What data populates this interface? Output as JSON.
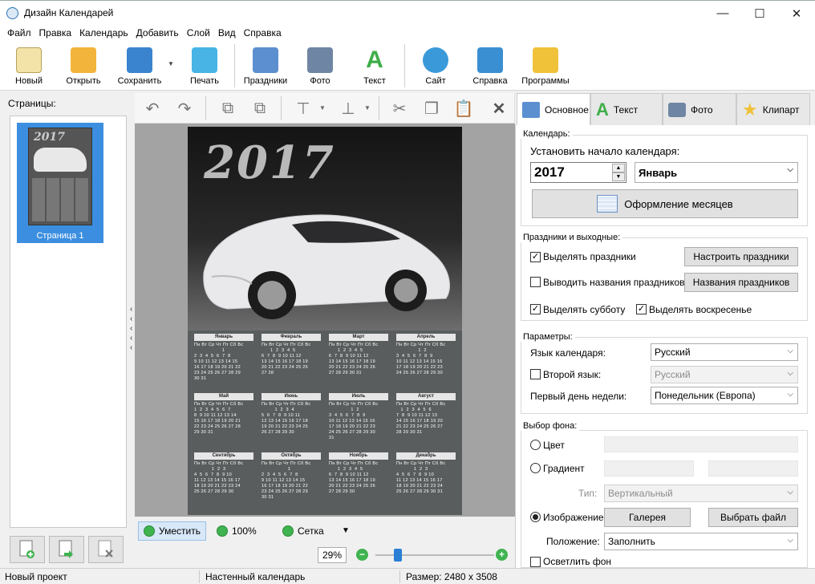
{
  "window": {
    "title": "Дизайн Календарей",
    "minimize": "—",
    "maximize": "☐",
    "close": "✕"
  },
  "menu": [
    "Файл",
    "Правка",
    "Календарь",
    "Добавить",
    "Слой",
    "Вид",
    "Справка"
  ],
  "toolbar": [
    {
      "label": "Новый",
      "icon": "new-document-icon",
      "color": "#f4e3a8"
    },
    {
      "label": "Открыть",
      "icon": "folder-icon",
      "color": "#f3b43b"
    },
    {
      "label": "Сохранить",
      "icon": "floppy-disk-icon",
      "color": "#3a83cf"
    },
    {
      "label": "Печать",
      "icon": "printer-icon",
      "color": "#47b4e5"
    },
    {
      "label": "Праздники",
      "icon": "calendar-icon",
      "color": "#5b8fcf"
    },
    {
      "label": "Фото",
      "icon": "camera-icon",
      "color": "#6e86a3"
    },
    {
      "label": "Текст",
      "icon": "text-a-icon",
      "color": "#3fae49"
    },
    {
      "label": "Сайт",
      "icon": "globe-icon",
      "color": "#3a9ad9"
    },
    {
      "label": "Справка",
      "icon": "help-book-icon",
      "color": "#3a8fd2"
    },
    {
      "label": "Программы",
      "icon": "box-icon",
      "color": "#f0c23a"
    }
  ],
  "pages": {
    "label": "Страницы:",
    "items": [
      {
        "label": "Страница 1",
        "year": "2017"
      }
    ]
  },
  "poster": {
    "year": "2017"
  },
  "months": [
    {
      "name": "Январь",
      "rows": [
        "Пн Вт Ср Чт Пт Сб Вс",
        "                   1",
        "2  3  4  5  6  7  8",
        "9 10 11 12 13 14 15",
        "16 17 18 19 20 21 22",
        "23 24 25 26 27 28 29",
        "30 31"
      ]
    },
    {
      "name": "Февраль",
      "rows": [
        "Пн Вт Ср Чт Пт Сб Вс",
        "      1  2  3  4  5",
        "6  7  8  9 10 11 12",
        "13 14 15 16 17 18 19",
        "20 21 22 23 24 25 26",
        "27 28"
      ]
    },
    {
      "name": "Март",
      "rows": [
        "Пн Вт Ср Чт Пт Сб Вс",
        "      1  2  3  4  5",
        "6  7  8  9 10 11 12",
        "13 14 15 16 17 18 19",
        "20 21 22 23 24 25 26",
        "27 28 29 30 31"
      ]
    },
    {
      "name": "Апрель",
      "rows": [
        "Пн Вт Ср Чт Пт Сб Вс",
        "               1  2",
        "3  4  5  6  7  8  9",
        "10 11 12 13 14 15 16",
        "17 18 19 20 21 22 23",
        "24 25 26 27 28 29 30"
      ]
    },
    {
      "name": "Май",
      "rows": [
        "Пн Вт Ср Чт Пт Сб Вс",
        "1  2  3  4  5  6  7",
        "8  9 10 11 12 13 14",
        "15 16 17 18 19 20 21",
        "22 23 24 25 26 27 28",
        "29 30 31"
      ]
    },
    {
      "name": "Июнь",
      "rows": [
        "Пн Вт Ср Чт Пт Сб Вс",
        "         1  2  3  4",
        "5  6  7  8  9 10 11",
        "12 13 14 15 16 17 18",
        "19 20 21 22 23 24 25",
        "26 27 28 29 30"
      ]
    },
    {
      "name": "Июль",
      "rows": [
        "Пн Вт Ср Чт Пт Сб Вс",
        "               1  2",
        "3  4  5  6  7  8  9",
        "10 11 12 13 14 15 16",
        "17 18 19 20 21 22 23",
        "24 25 26 27 28 29 30",
        "31"
      ]
    },
    {
      "name": "Август",
      "rows": [
        "Пн Вт Ср Чт Пт Сб Вс",
        "   1  2  3  4  5  6",
        "7  8  9 10 11 12 13",
        "14 15 16 17 18 19 20",
        "21 22 23 24 25 26 27",
        "28 29 30 31"
      ]
    },
    {
      "name": "Сентябрь",
      "rows": [
        "Пн Вт Ср Чт Пт Сб Вс",
        "            1  2  3",
        "4  5  6  7  8  9 10",
        "11 12 13 14 15 16 17",
        "18 19 20 21 22 23 24",
        "25 26 27 28 29 30"
      ]
    },
    {
      "name": "Октябрь",
      "rows": [
        "Пн Вт Ср Чт Пт Сб Вс",
        "                  1",
        "2  3  4  5  6  7  8",
        "9 10 11 12 13 14 15",
        "16 17 18 19 20 21 22",
        "23 24 25 26 27 28 29",
        "30 31"
      ]
    },
    {
      "name": "Ноябрь",
      "rows": [
        "Пн Вт Ср Чт Пт Сб Вс",
        "      1  2  3  4  5",
        "6  7  8  9 10 11 12",
        "13 14 15 16 17 18 19",
        "20 21 22 23 24 25 26",
        "27 28 29 30"
      ]
    },
    {
      "name": "Декабрь",
      "rows": [
        "Пн Вт Ср Чт Пт Сб Вс",
        "            1  2  3",
        "4  5  6  7  8  9 10",
        "11 12 13 14 15 16 17",
        "18 19 20 21 22 23 24",
        "25 26 27 28 29 30 31"
      ]
    }
  ],
  "bottom": {
    "fit": "Уместить",
    "full": "100%",
    "grid": "Сетка",
    "zoom": "29%"
  },
  "tabs": [
    {
      "label": "Основное",
      "icon": "calendar-tab-icon"
    },
    {
      "label": "Текст",
      "icon": "text-a-icon"
    },
    {
      "label": "Фото",
      "icon": "camera-icon"
    },
    {
      "label": "Клипарт",
      "icon": "star-icon"
    }
  ],
  "calendar": {
    "title": "Календарь:",
    "start_label": "Установить начало календаря:",
    "year": "2017",
    "month": "Январь",
    "months_button": "Оформление месяцев"
  },
  "holidays": {
    "title": "Праздники и выходные:",
    "highlight": "Выделять праздники",
    "configure": "Настроить праздники",
    "show_names": "Выводить названия праздников",
    "names_button": "Названия праздников",
    "saturday": "Выделять субботу",
    "sunday": "Выделять воскресенье"
  },
  "params": {
    "title": "Параметры:",
    "lang_label": "Язык календаря:",
    "lang": "Русский",
    "second_label": "Второй язык:",
    "second": "Русский",
    "firstday_label": "Первый день недели:",
    "firstday": "Понедельник (Европа)"
  },
  "bg": {
    "title": "Выбор фона:",
    "color": "Цвет",
    "gradient": "Градиент",
    "type_label": "Тип:",
    "type": "Вертикальный",
    "image": "Изображение",
    "gallery": "Галерея",
    "choose": "Выбрать файл",
    "pos_label": "Положение:",
    "pos": "Заполнить",
    "lighten": "Осветлить фон"
  },
  "status": {
    "project": "Новый проект",
    "kind": "Настенный календарь",
    "size": "Размер: 2480 x 3508"
  }
}
